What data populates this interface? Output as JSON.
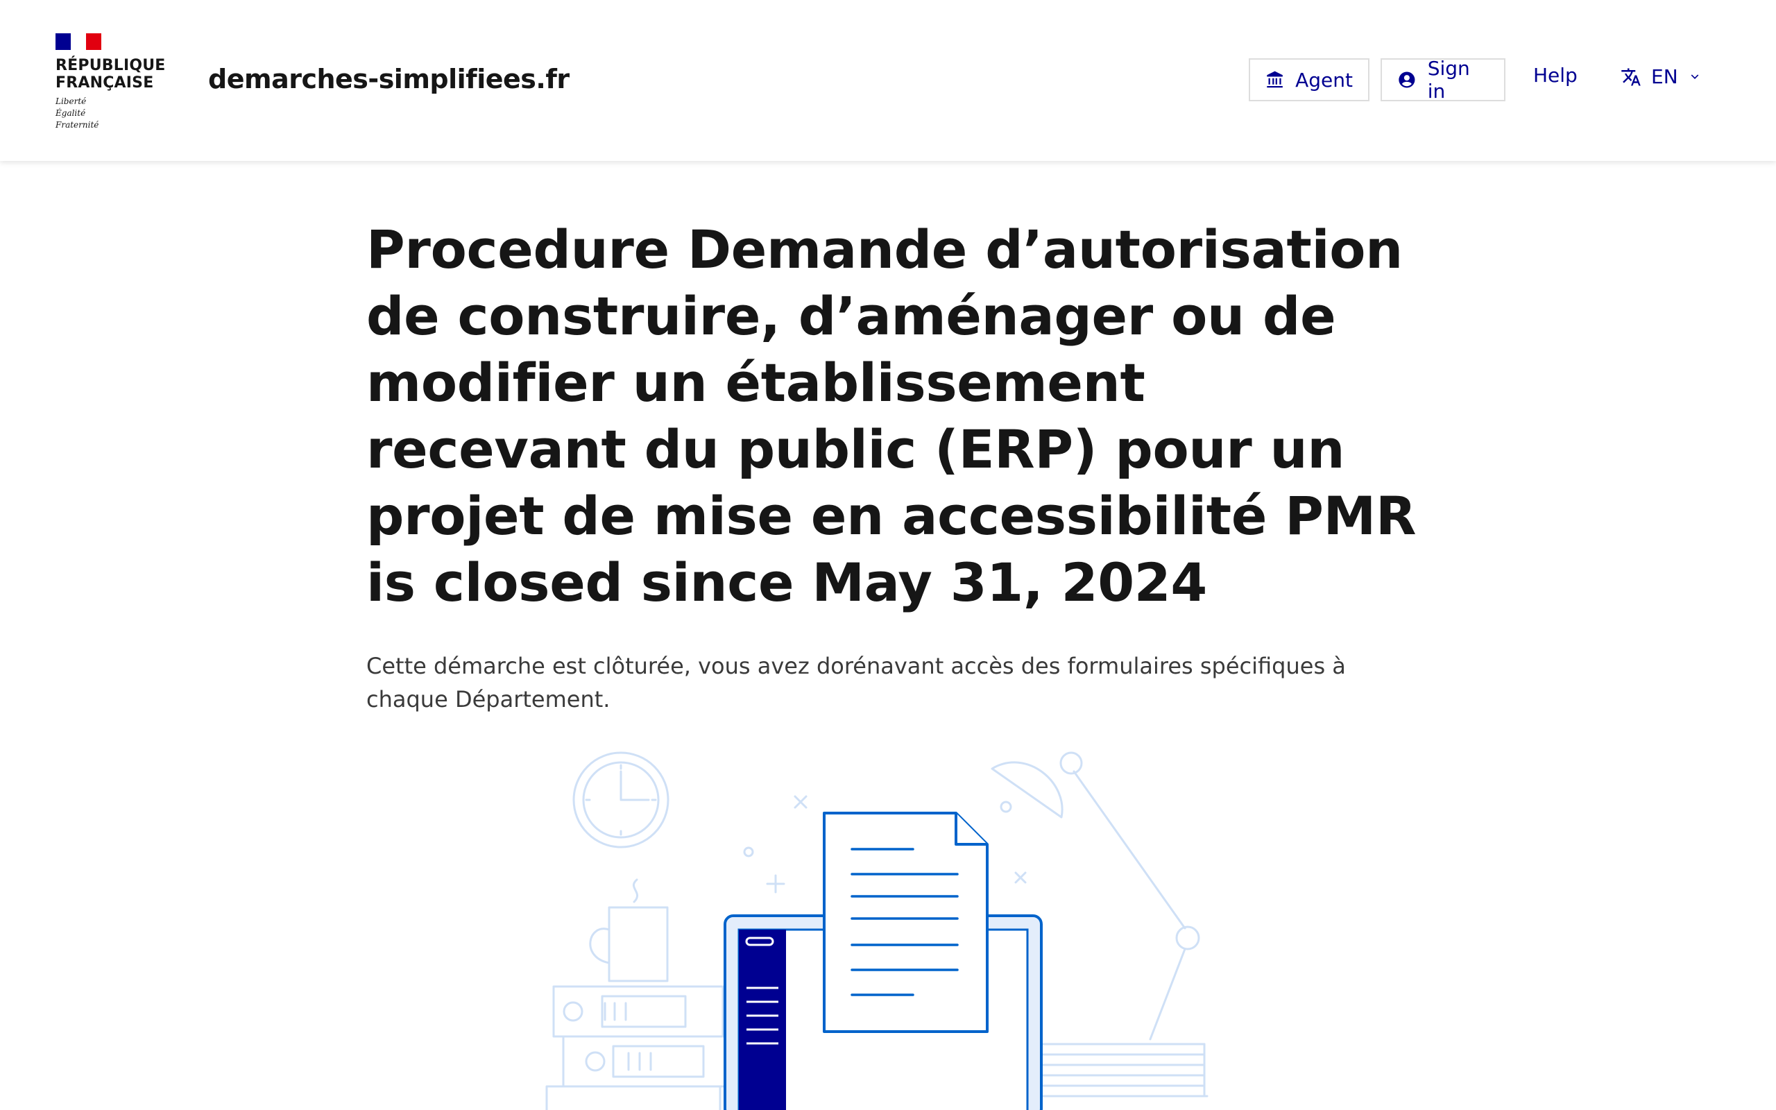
{
  "header": {
    "marianne": {
      "line1": "RÉPUBLIQUE",
      "line2": "FRANÇAISE",
      "devise": [
        "Liberté",
        "Égalité",
        "Fraternité"
      ],
      "flag_colors": [
        "#000091",
        "#ffffff",
        "#e1000f"
      ]
    },
    "site_name": "demarches-simplifiees.fr",
    "agent_label": "Agent",
    "signin_label": "Sign in",
    "help_label": "Help",
    "language": "EN"
  },
  "main": {
    "title": "Procedure Demande d’autorisation de construire, d’aménager ou de modifier un établissement recevant du public (ERP) pour un projet de mise en accessibilité PMR is closed since May 31, 2024",
    "description": "Cette démarche est clôturée, vous avez dorénavant accès des formulaires spécifiques à chaque Département."
  },
  "colors": {
    "primary": "#000091",
    "illustration_light": "#cfe0f6",
    "illustration_main": "#0063cb"
  }
}
